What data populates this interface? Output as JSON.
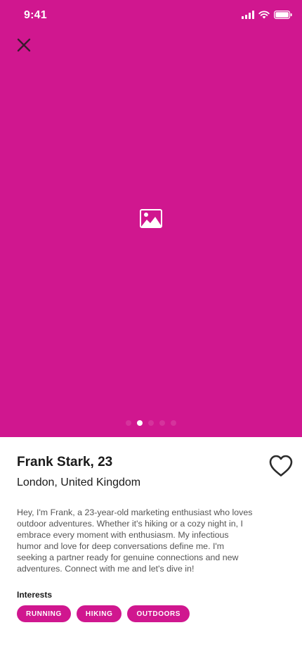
{
  "status_bar": {
    "time": "9:41"
  },
  "colors": {
    "accent": "#D0178F",
    "text": "#1a1a1a",
    "muted": "#555555"
  },
  "hero": {
    "placeholder_icon": "image-icon",
    "close_icon": "close-icon",
    "photo_count": 5,
    "active_photo_index": 1
  },
  "profile": {
    "name_age": "Frank Stark, 23",
    "location": "London, United Kingdom",
    "bio": "Hey, I'm Frank, a 23-year-old marketing enthusiast who loves outdoor adventures. Whether it's hiking or a cozy night in, I embrace every moment with enthusiasm. My infectious humor and love for deep conversations define me. I'm seeking a partner ready for genuine connections and new adventures. Connect with me and let's dive in!",
    "like_icon": "heart-icon"
  },
  "interests": {
    "title": "Interests",
    "items": [
      "RUNNING",
      "HIKING",
      "OUTDOORS"
    ]
  }
}
